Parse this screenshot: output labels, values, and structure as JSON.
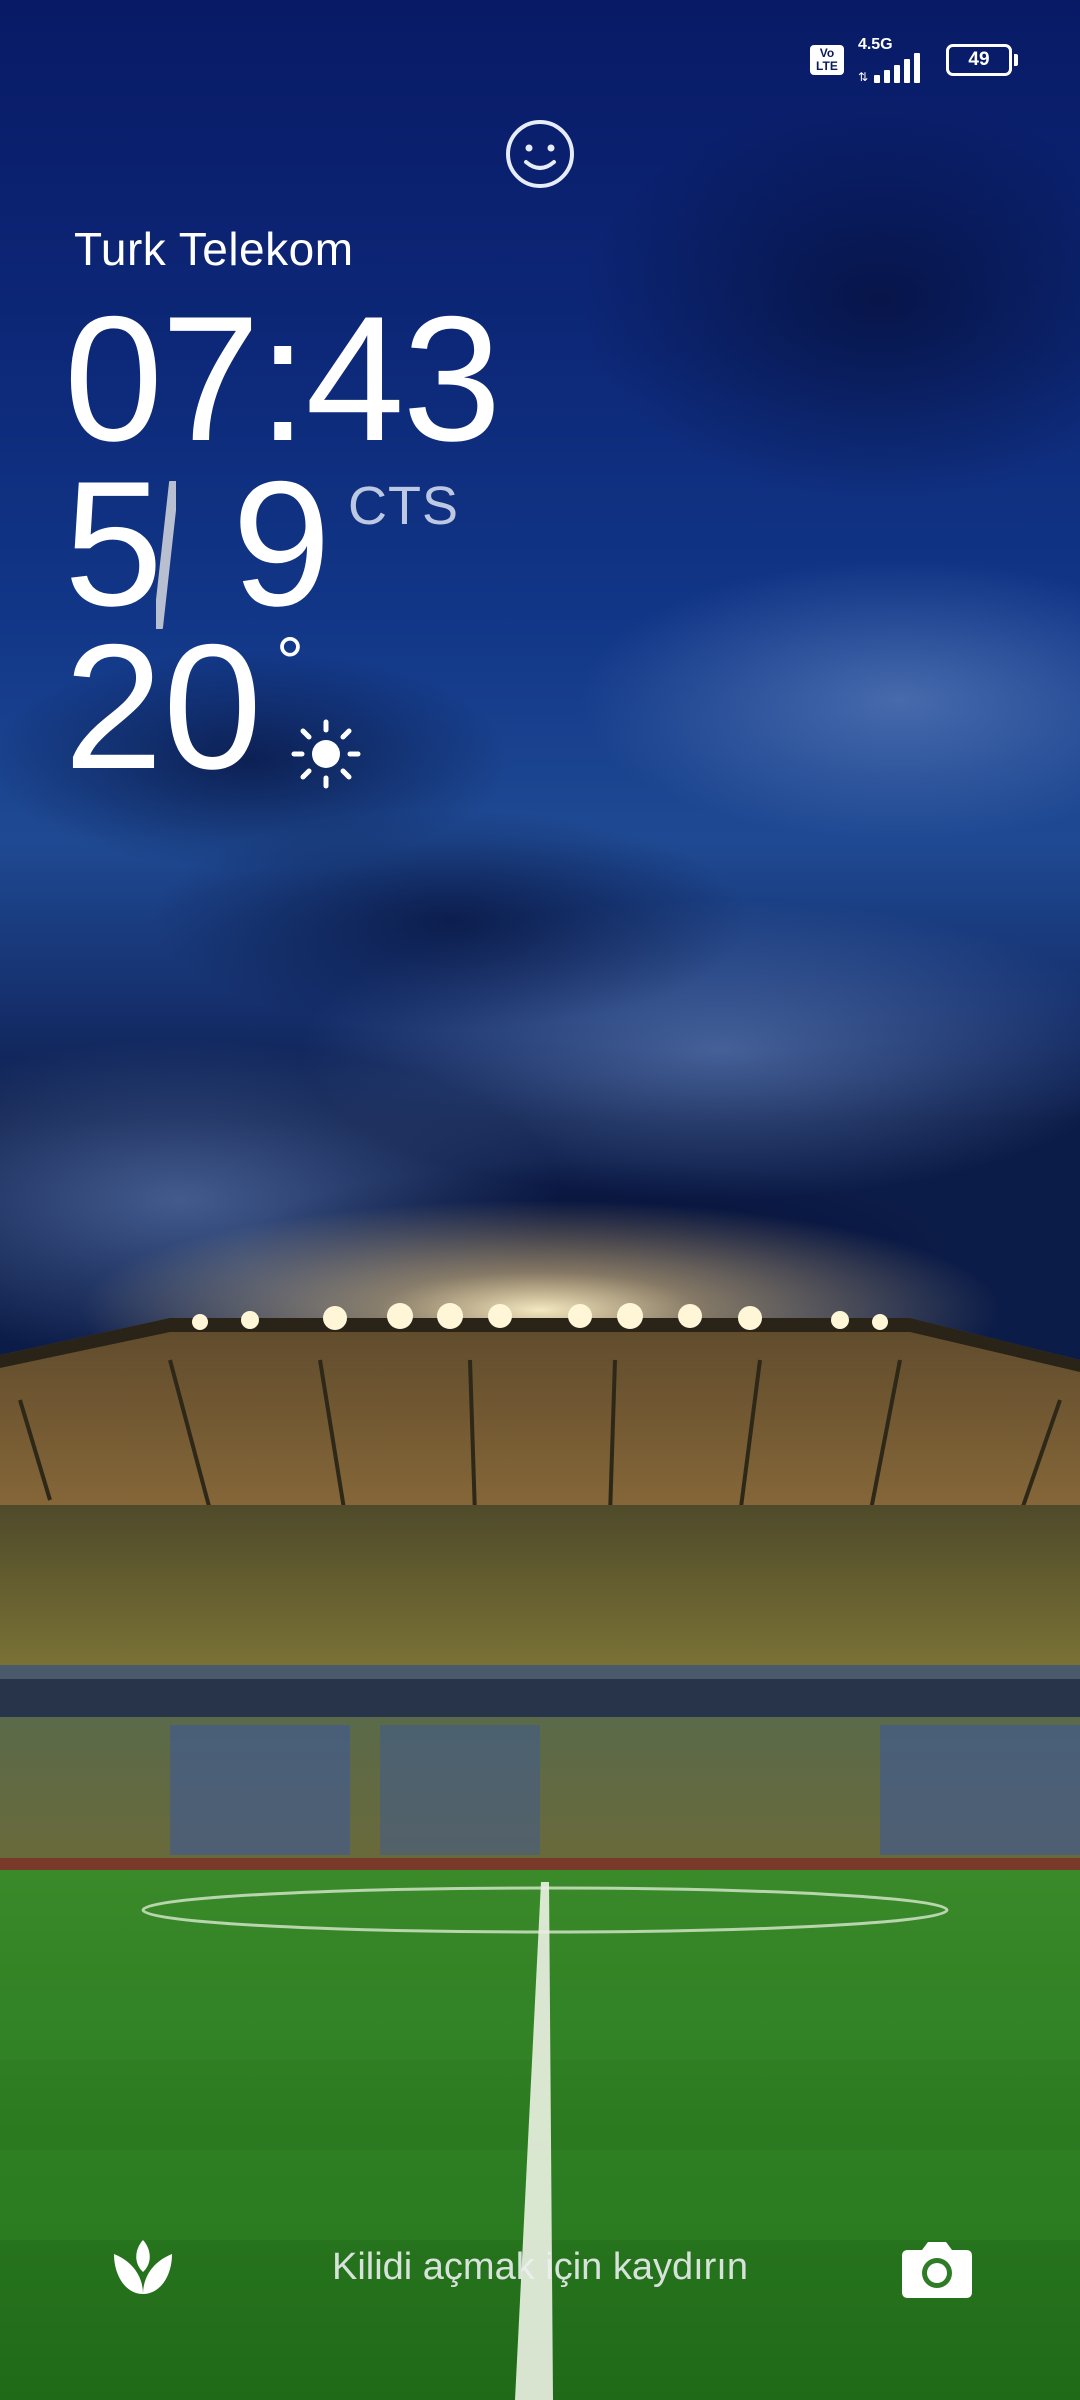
{
  "status_bar": {
    "volte_line1": "Vo",
    "volte_line2": "LTE",
    "network": "4.5G",
    "signal_level": 5,
    "battery_percent": "49"
  },
  "lock_screen": {
    "carrier": "Turk Telekom",
    "time": "07:43",
    "date_day": "5",
    "date_month": "9",
    "weekday": "CTS",
    "temperature": "20",
    "temperature_unit": "°",
    "weather_icon": "sun-icon"
  },
  "bottom_bar": {
    "left_icon": "flower-icon",
    "unlock_hint": "Kilidi açmak için kaydırın",
    "right_icon": "camera-icon"
  },
  "colors": {
    "sky_top": "#0a1d6a",
    "sky_mid": "#163c8c",
    "pitch": "#2f8a2a",
    "text": "#ffffff"
  }
}
